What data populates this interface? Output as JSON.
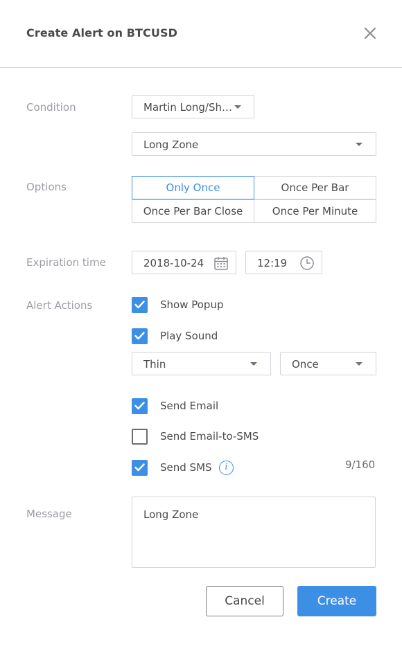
{
  "dialog": {
    "title": "Create Alert on BTCUSD",
    "close_icon": "close-icon"
  },
  "condition": {
    "label": "Condition",
    "indicator_value": "Martin Long/Sh…",
    "zone_value": "Long Zone"
  },
  "options": {
    "label": "Options",
    "items": [
      "Only Once",
      "Once Per Bar",
      "Once Per Bar Close",
      "Once Per Minute"
    ],
    "selected": "Only Once"
  },
  "expiration": {
    "label": "Expiration time",
    "date": "2018-10-24",
    "time": "12:19",
    "date_icon": "calendar-icon",
    "time_icon": "clock-icon"
  },
  "actions": {
    "label": "Alert Actions",
    "show_popup": {
      "label": "Show Popup",
      "checked": true
    },
    "play_sound": {
      "label": "Play Sound",
      "checked": true
    },
    "sound_name": "Thin",
    "sound_repeat": "Once",
    "send_email": {
      "label": "Send Email",
      "checked": true
    },
    "send_email_sms": {
      "label": "Send Email-to-SMS",
      "checked": false
    },
    "send_sms": {
      "label": "Send SMS",
      "checked": true
    },
    "info_glyph": "i",
    "sms_counter": "9/160"
  },
  "message": {
    "label": "Message",
    "value": "Long Zone"
  },
  "buttons": {
    "cancel": "Cancel",
    "create": "Create"
  },
  "colors": {
    "accent": "#3d8fe5",
    "label": "#9b9ea3",
    "text": "#4a4a4a",
    "border": "#d1d4dc"
  }
}
